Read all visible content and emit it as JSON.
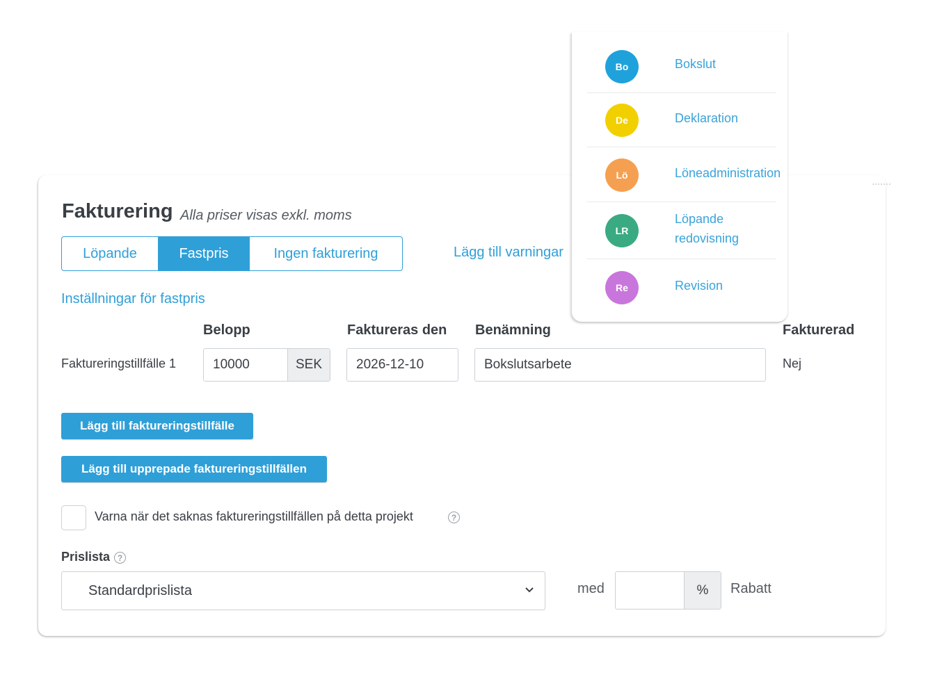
{
  "header": {
    "title": "Fakturering",
    "subtitle": "Alla priser visas exkl. moms"
  },
  "billing_tabs": [
    {
      "label": "Löpande",
      "active": false
    },
    {
      "label": "Fastpris",
      "active": true
    },
    {
      "label": "Ingen fakturering",
      "active": false
    }
  ],
  "warnings_link": "Lägg till varningar",
  "settings_link": "Inställningar för fastpris",
  "table": {
    "headers": {
      "amount": "Belopp",
      "invoice_date": "Faktureras den",
      "name": "Benämning",
      "invoiced": "Fakturerad"
    },
    "rows": [
      {
        "label": "Faktureringstillfälle 1",
        "amount": "10000",
        "currency": "SEK",
        "invoice_date": "2026-12-10",
        "name": "Bokslutsarbete",
        "invoiced": "Nej"
      }
    ]
  },
  "buttons": {
    "add_occasion": "Lägg till faktureringstillfälle",
    "add_repeated": "Lägg till upprepade faktureringstillfällen"
  },
  "warn_checkbox": {
    "label": "Varna när det saknas faktureringstillfällen på detta projekt",
    "checked": false,
    "help_icon": "question-circle-icon"
  },
  "pricelist": {
    "label": "Prislista",
    "selected": "Standardprislista",
    "with_label": "med",
    "discount_value": "",
    "percent_symbol": "%",
    "discount_label": "Rabatt"
  },
  "dropdown": {
    "items": [
      {
        "initials": "Bo",
        "label": "Bokslut",
        "color": "#1fa2db"
      },
      {
        "initials": "De",
        "label": "Deklaration",
        "color": "#f2d000"
      },
      {
        "initials": "Lö",
        "label": "Löneadministration",
        "color": "#f5a050"
      },
      {
        "initials": "LR",
        "label": "Löpande redovisning",
        "color": "#3aaa82"
      },
      {
        "initials": "Re",
        "label": "Revision",
        "color": "#c976dc"
      }
    ]
  },
  "colors": {
    "accent": "#2f9fd8",
    "text": "#3a3f45",
    "border": "#ccd1d6"
  }
}
